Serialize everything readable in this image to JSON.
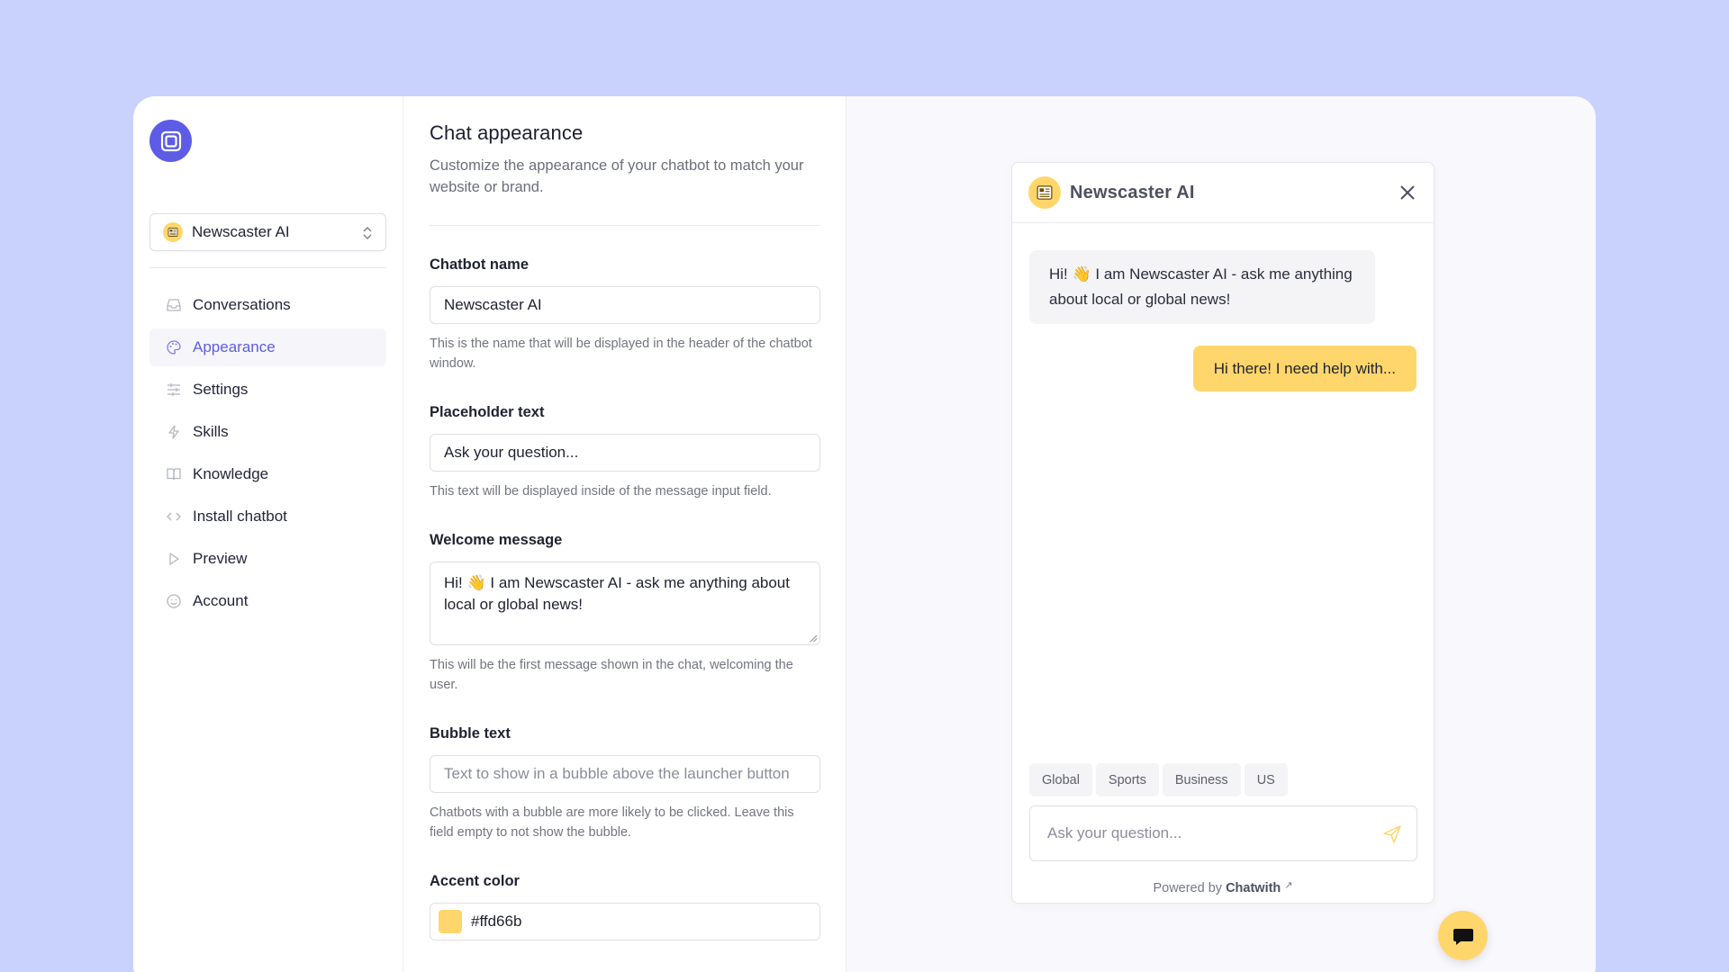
{
  "brand": {
    "logo_icon": "square-stack-icon",
    "accent": "#5d5ce6"
  },
  "sidebar": {
    "bot_selector": {
      "label": "Newscaster AI",
      "icon": "newspaper-icon"
    },
    "items": [
      {
        "label": "Conversations",
        "icon": "inbox-icon",
        "active": false
      },
      {
        "label": "Appearance",
        "icon": "palette-icon",
        "active": true
      },
      {
        "label": "Settings",
        "icon": "sliders-icon",
        "active": false
      },
      {
        "label": "Skills",
        "icon": "bolt-icon",
        "active": false
      },
      {
        "label": "Knowledge",
        "icon": "book-icon",
        "active": false
      },
      {
        "label": "Install chatbot",
        "icon": "code-icon",
        "active": false
      },
      {
        "label": "Preview",
        "icon": "play-icon",
        "active": false
      },
      {
        "label": "Account",
        "icon": "user-circle-icon",
        "active": false
      }
    ]
  },
  "form": {
    "title": "Chat appearance",
    "subtitle": "Customize the appearance of your chatbot to match your website or brand.",
    "chatbot_name": {
      "label": "Chatbot name",
      "value": "Newscaster AI",
      "help": "This is the name that will be displayed in the header of the chatbot window."
    },
    "placeholder_text": {
      "label": "Placeholder text",
      "value": "Ask your question...",
      "help": "This text will be displayed inside of the message input field."
    },
    "welcome_message": {
      "label": "Welcome message",
      "value": "Hi! 👋 I am Newscaster AI - ask me anything about local or global news!",
      "help": "This will be the first message shown in the chat, welcoming the user."
    },
    "bubble_text": {
      "label": "Bubble text",
      "placeholder": "Text to show in a bubble above the launcher button",
      "help": "Chatbots with a bubble are more likely to be clicked. Leave this field empty to not show the bubble."
    },
    "accent_color": {
      "label": "Accent color",
      "value": "#ffd66b"
    }
  },
  "chat_preview": {
    "title": "Newscaster AI",
    "bot_message": "Hi! 👋 I am Newscaster AI - ask me anything about local or global news!",
    "user_message": "Hi there! I need help with...",
    "chips": [
      "Global",
      "Sports",
      "Business",
      "US"
    ],
    "input_placeholder": "Ask your question...",
    "powered_prefix": "Powered by",
    "powered_brand": "Chatwith",
    "powered_arrow": "↗",
    "accent": "#ffd66b"
  }
}
